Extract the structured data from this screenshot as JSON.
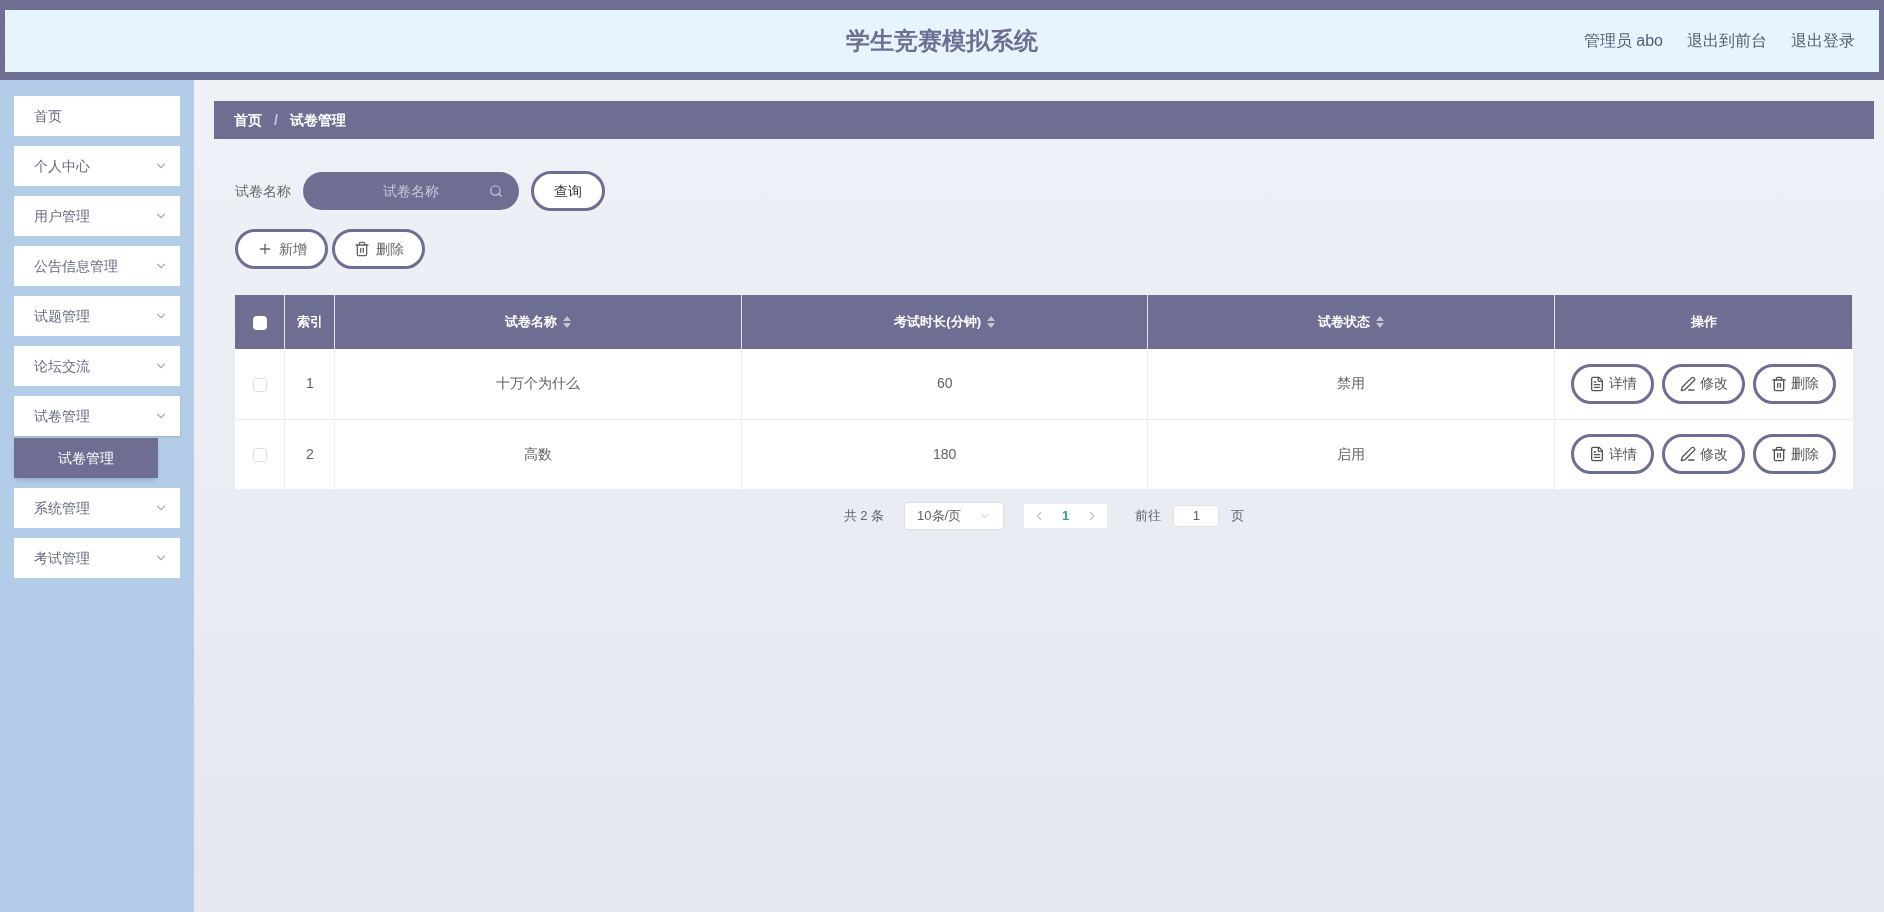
{
  "header": {
    "title": "学生竞赛模拟系统",
    "links": [
      "管理员 abo",
      "退出到前台",
      "退出登录"
    ]
  },
  "sidebar": {
    "items": [
      {
        "label": "首页",
        "expandable": false,
        "expanded": false
      },
      {
        "label": "个人中心",
        "expandable": true,
        "expanded": false
      },
      {
        "label": "用户管理",
        "expandable": true,
        "expanded": false
      },
      {
        "label": "公告信息管理",
        "expandable": true,
        "expanded": false
      },
      {
        "label": "试题管理",
        "expandable": true,
        "expanded": false
      },
      {
        "label": "论坛交流",
        "expandable": true,
        "expanded": false
      },
      {
        "label": "试卷管理",
        "expandable": true,
        "expanded": true,
        "children": [
          {
            "label": "试卷管理",
            "selected": true
          }
        ]
      },
      {
        "label": "系统管理",
        "expandable": true,
        "expanded": false
      },
      {
        "label": "考试管理",
        "expandable": true,
        "expanded": false
      }
    ]
  },
  "breadcrumb": {
    "separator": "/",
    "items": [
      "首页",
      "试卷管理"
    ]
  },
  "search": {
    "label": "试卷名称",
    "placeholder": "试卷名称",
    "button": "查询"
  },
  "toolbar": [
    {
      "kind": "add",
      "label": "新增"
    },
    {
      "kind": "delete",
      "label": "删除"
    }
  ],
  "table": {
    "columns": [
      {
        "label": "索引",
        "sortable": false
      },
      {
        "label": "试卷名称",
        "sortable": true
      },
      {
        "label": "考试时长(分钟)",
        "sortable": true
      },
      {
        "label": "试卷状态",
        "sortable": true
      },
      {
        "label": "操作",
        "sortable": false
      }
    ],
    "header_checked": false,
    "rows": [
      {
        "checked": false,
        "cells": [
          "1",
          "十万个为什么",
          "60",
          "禁用"
        ],
        "actions": [
          {
            "kind": "detail",
            "label": "详情"
          },
          {
            "kind": "edit",
            "label": "修改"
          },
          {
            "kind": "delete",
            "label": "删除"
          }
        ]
      },
      {
        "checked": false,
        "cells": [
          "2",
          "高数",
          "180",
          "启用"
        ],
        "actions": [
          {
            "kind": "detail",
            "label": "详情"
          },
          {
            "kind": "edit",
            "label": "修改"
          },
          {
            "kind": "delete",
            "label": "删除"
          }
        ]
      }
    ]
  },
  "pagination": {
    "total": "共 2 条",
    "page_size": "10条/页",
    "pages": [
      {
        "label": "1",
        "selected": true
      }
    ],
    "goto_label": "前往",
    "goto_value": "1",
    "goto_suffix": "页"
  }
}
